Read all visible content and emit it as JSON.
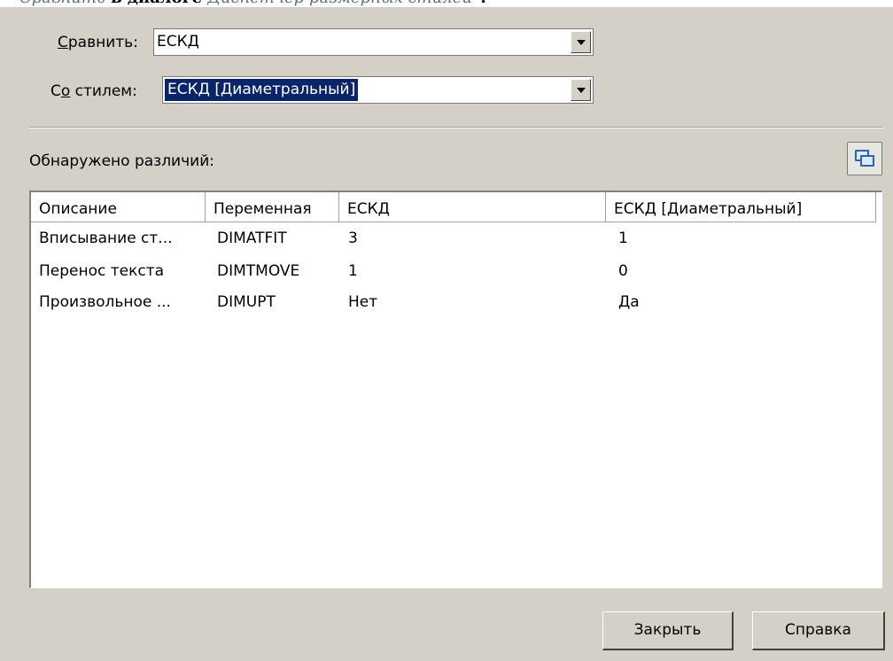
{
  "caption": {
    "prefix": "Сравнить",
    "middle": " в диалоге ",
    "suffix": "Диспетчер размерных стилей",
    "end": "\"."
  },
  "compare": {
    "label_before": "",
    "label_accel": "С",
    "label_after": "равнить:",
    "value": "ЕСКД"
  },
  "with_style": {
    "label_before": "С",
    "label_accel": "о",
    "label_after": " стилем:",
    "value": "ЕСКД [Диаметральный]"
  },
  "differences_label": "Обнаружено различий:",
  "copy_icon": "copy-to-clipboard-icon",
  "table": {
    "columns": [
      "Описание",
      "Переменная",
      "ЕСКД",
      "ЕСКД [Диаметральный]"
    ],
    "rows": [
      [
        "Вписывание ст...",
        "DIMATFIT",
        "3",
        "1"
      ],
      [
        "Перенос текста",
        "DIMTMOVE",
        "1",
        "0"
      ],
      [
        "Произвольное ...",
        "DIMUPT",
        "Нет",
        "Да"
      ]
    ]
  },
  "buttons": {
    "close": "Закрыть",
    "help": "Справка"
  },
  "colors": {
    "dialog_bg": "#d4d0c8",
    "selection": "#0a246a",
    "icon_blue": "#2b63b4"
  }
}
